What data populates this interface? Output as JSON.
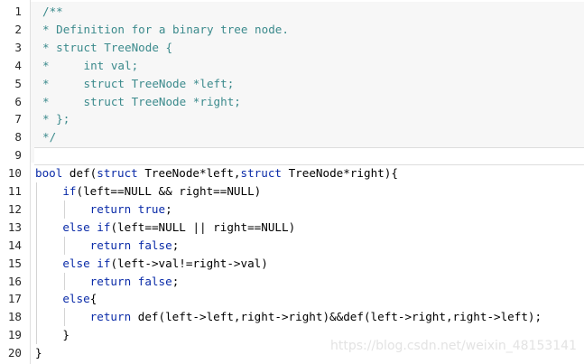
{
  "editor": {
    "lines": [
      {
        "n": "1",
        "text": "/**",
        "kind": "comment"
      },
      {
        "n": "2",
        "text": "* Definition for a binary tree node.",
        "kind": "comment"
      },
      {
        "n": "3",
        "text": "* struct TreeNode {",
        "kind": "comment"
      },
      {
        "n": "4",
        "text": "*     int val;",
        "kind": "comment"
      },
      {
        "n": "5",
        "text": "*     struct TreeNode *left;",
        "kind": "comment"
      },
      {
        "n": "6",
        "text": "*     struct TreeNode *right;",
        "kind": "comment"
      },
      {
        "n": "7",
        "text": "* };",
        "kind": "comment"
      },
      {
        "n": "8",
        "text": "*/",
        "kind": "comment"
      },
      {
        "n": "9",
        "text": "",
        "kind": "blank"
      },
      {
        "n": "10",
        "text": "bool def(struct TreeNode*left,struct TreeNode*right){",
        "kind": "code"
      },
      {
        "n": "11",
        "text": "    if(left==NULL && right==NULL)",
        "kind": "code"
      },
      {
        "n": "12",
        "text": "        return true;",
        "kind": "code"
      },
      {
        "n": "13",
        "text": "    else if(left==NULL || right==NULL)",
        "kind": "code"
      },
      {
        "n": "14",
        "text": "        return false;",
        "kind": "code"
      },
      {
        "n": "15",
        "text": "    else if(left->val!=right->val)",
        "kind": "code"
      },
      {
        "n": "16",
        "text": "        return false;",
        "kind": "code"
      },
      {
        "n": "17",
        "text": "    else{",
        "kind": "code"
      },
      {
        "n": "18",
        "text": "        return def(left->left,right->right)&&def(left->right,right->left);",
        "kind": "code"
      },
      {
        "n": "19",
        "text": "    }",
        "kind": "code"
      },
      {
        "n": "20",
        "text": "}",
        "kind": "code"
      }
    ],
    "keywords": [
      "bool",
      "struct",
      "if",
      "else",
      "return",
      "true",
      "false"
    ]
  },
  "watermark": {
    "text": "https://blog.csdn.net/weixin_48153141"
  },
  "colors": {
    "comment": "#3b8a8c",
    "keyword": "#0a2ba8",
    "code": "#000000",
    "comment_bg": "#f7f7f7"
  }
}
